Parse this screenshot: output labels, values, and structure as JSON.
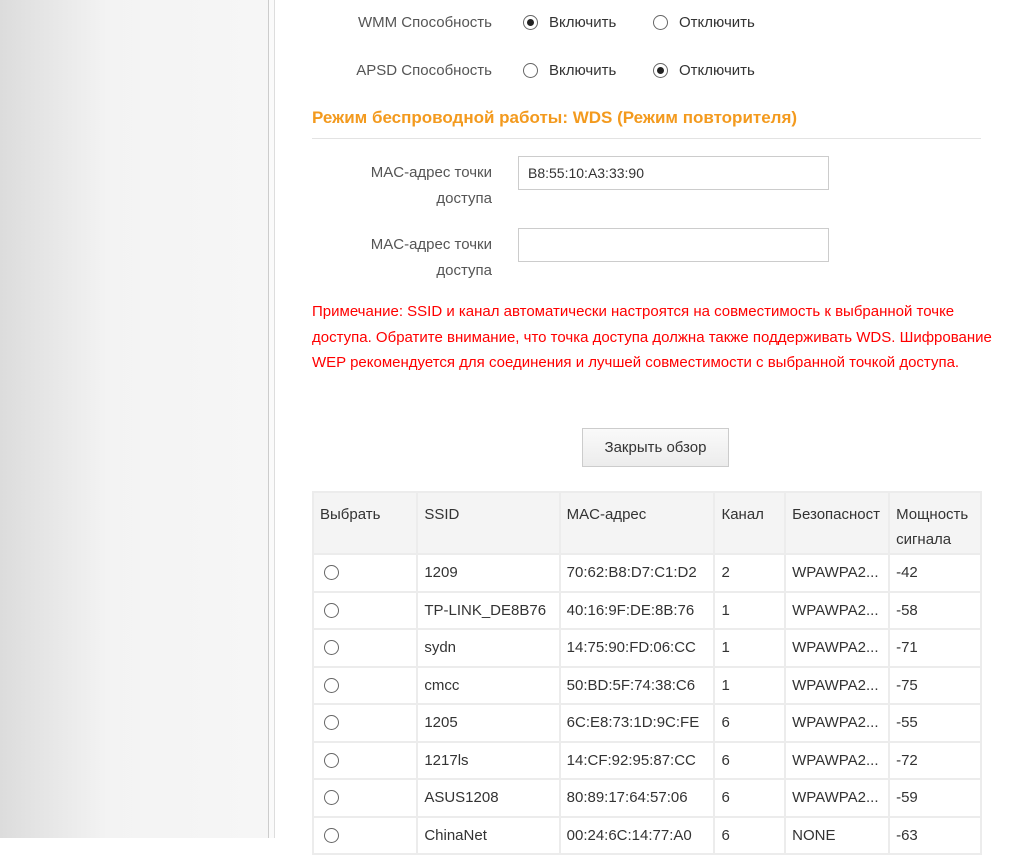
{
  "wmm": {
    "label": "WMM Способность",
    "on": "Включить",
    "off": "Отключить",
    "selected": "on"
  },
  "apsd": {
    "label": "APSD Способность",
    "on": "Включить",
    "off": "Отключить",
    "selected": "off"
  },
  "section_title": "Режим беспроводной работы: WDS (Режим повторителя)",
  "mac1": {
    "label": "MAC-адрес точки доступа",
    "value": "B8:55:10:A3:33:90"
  },
  "mac2": {
    "label": "MAC-адрес точки доступа",
    "value": ""
  },
  "note": "Примечание: SSID и канал автоматически настроятся на совместимость к выбранной точке доступа. Обратите внимание, что точка доступа должна также поддерживать WDS. Шифрование WEP рекомендуется для соединения и лучшей совместимости с выбранной точкой доступа.",
  "close_button": "Закрыть обзор",
  "table": {
    "headers": [
      "Выбрать",
      "SSID",
      "MAC-адрес",
      "Канал",
      "Безопасност",
      "Мощность сигнала"
    ],
    "rows": [
      [
        "1209",
        "70:62:B8:D7:C1:D2",
        "2",
        "WPAWPA2...",
        "-42"
      ],
      [
        "TP-LINK_DE8B76",
        "40:16:9F:DE:8B:76",
        "1",
        "WPAWPA2...",
        "-58"
      ],
      [
        "sydn",
        "14:75:90:FD:06:CC",
        "1",
        "WPAWPA2...",
        "-71"
      ],
      [
        "cmcc",
        "50:BD:5F:74:38:C6",
        "1",
        "WPAWPA2...",
        "-75"
      ],
      [
        "1205",
        "6C:E8:73:1D:9C:FE",
        "6",
        "WPAWPA2...",
        "-55"
      ],
      [
        "1217ls",
        "14:CF:92:95:87:CC",
        "6",
        "WPAWPA2...",
        "-72"
      ],
      [
        "ASUS1208",
        "80:89:17:64:57:06",
        "6",
        "WPAWPA2...",
        "-59"
      ],
      [
        "ChinaNet",
        "00:24:6C:14:77:A0",
        "6",
        "NONE",
        "-63"
      ]
    ]
  }
}
